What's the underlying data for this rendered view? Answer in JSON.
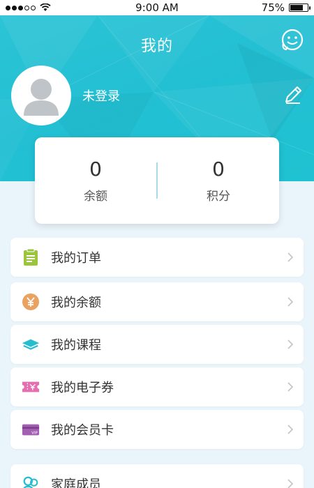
{
  "status_bar": {
    "time": "9:00 AM",
    "battery": "75%"
  },
  "header": {
    "title": "我的",
    "username": "未登录"
  },
  "stats": [
    {
      "value": "0",
      "label": "余额"
    },
    {
      "value": "0",
      "label": "积分"
    }
  ],
  "menu": [
    {
      "label": "我的订单",
      "icon": "order-clipboard-icon",
      "color": "#9bc53d"
    },
    {
      "label": "我的余额",
      "icon": "yuan-coin-icon",
      "color": "#e9a25f"
    },
    {
      "label": "我的课程",
      "icon": "course-book-icon",
      "color": "#26bdd0"
    },
    {
      "label": "我的电子券",
      "icon": "ticket-icon",
      "color": "#e36fb0"
    },
    {
      "label": "我的会员卡",
      "icon": "vip-card-icon",
      "color": "#a35fb2"
    },
    {
      "label": "家庭成员",
      "icon": "family-members-icon",
      "color": "#26bdd0"
    }
  ],
  "colors": {
    "header": "#23bfd3",
    "background": "#eaf5fb"
  }
}
